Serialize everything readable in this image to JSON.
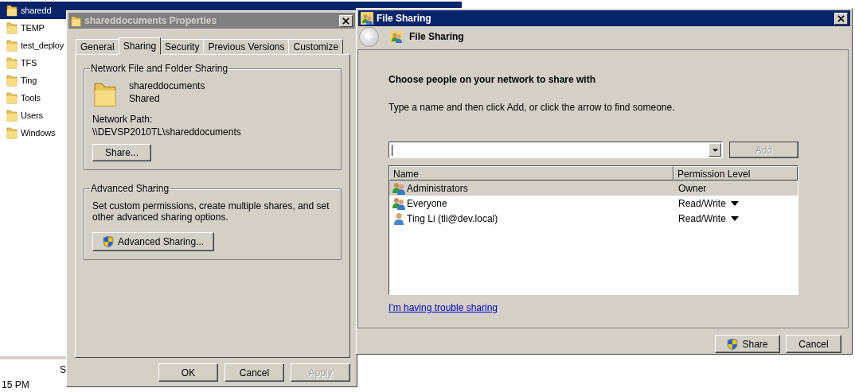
{
  "explorer": {
    "items": [
      {
        "name": "sharedd",
        "selected": true
      },
      {
        "name": "TEMP",
        "selected": false
      },
      {
        "name": "test_deploy",
        "selected": false
      },
      {
        "name": "TFS",
        "selected": false
      },
      {
        "name": "Ting",
        "selected": false
      },
      {
        "name": "Tools",
        "selected": false
      },
      {
        "name": "Users",
        "selected": false
      },
      {
        "name": "Windows",
        "selected": false
      }
    ],
    "column_fragment": "S",
    "time_fragment": "15 PM"
  },
  "properties_dialog": {
    "title": "shareddocuments Properties",
    "tabs": [
      {
        "label": "General",
        "selected": false
      },
      {
        "label": "Sharing",
        "selected": true
      },
      {
        "label": "Security",
        "selected": false
      },
      {
        "label": "Previous Versions",
        "selected": false
      },
      {
        "label": "Customize",
        "selected": false
      }
    ],
    "network_sharing": {
      "heading": "Network File and Folder Sharing",
      "folder_name": "shareddocuments",
      "status": "Shared",
      "path_label": "Network Path:",
      "path": "\\\\DEVSP2010TL\\shareddocuments",
      "button": "Share..."
    },
    "advanced_sharing": {
      "heading": "Advanced Sharing",
      "description": "Set custom permissions, create multiple shares, and set other advanced sharing options.",
      "button": "Advanced Sharing..."
    },
    "buttons": [
      {
        "label": "OK",
        "disabled": false
      },
      {
        "label": "Cancel",
        "disabled": false
      },
      {
        "label": "Apply",
        "disabled": true
      }
    ]
  },
  "file_sharing_dialog": {
    "title": "File Sharing",
    "nav_title": "File Sharing",
    "heading": "Choose people on your network to share with",
    "instruction": "Type a name and then click Add, or click the arrow to find someone.",
    "add_button": {
      "label": "Add",
      "disabled": true
    },
    "table": {
      "columns": [
        "Name",
        "Permission Level"
      ],
      "rows": [
        {
          "name": "Administrators",
          "kind": "group",
          "permission": "Owner",
          "has_menu": false,
          "selected": true
        },
        {
          "name": "Everyone",
          "kind": "group",
          "permission": "Read/Write",
          "has_menu": true,
          "selected": false
        },
        {
          "name": "Ting Li (tli@dev.local)",
          "kind": "user",
          "permission": "Read/Write",
          "has_menu": true,
          "selected": false
        }
      ]
    },
    "link": "I'm having trouble sharing",
    "buttons": [
      {
        "label": "Share",
        "shield": true
      },
      {
        "label": "Cancel",
        "shield": false
      }
    ]
  }
}
